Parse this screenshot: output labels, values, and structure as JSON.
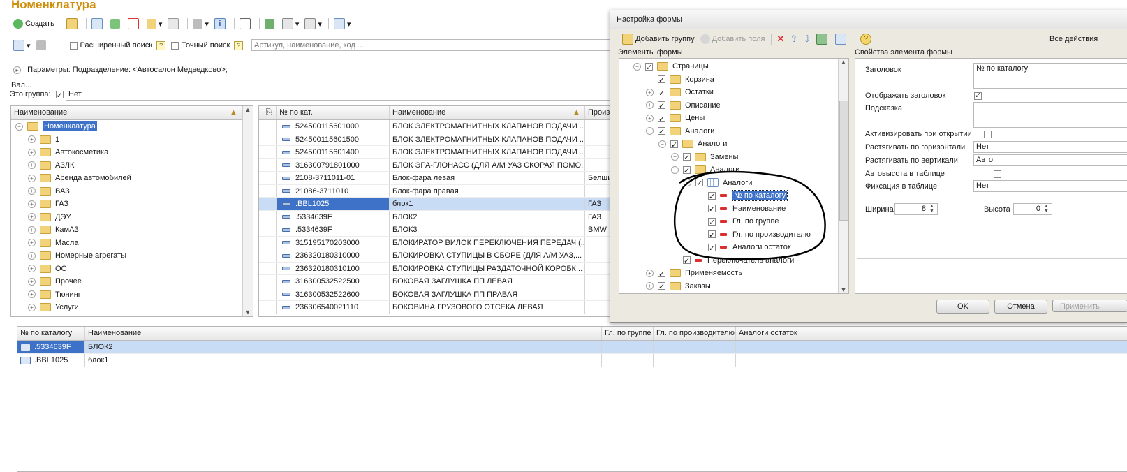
{
  "window_title": "Номенклатура",
  "toolbar": {
    "create_label": "Создать"
  },
  "search": {
    "extended_label": "Расширенный поиск",
    "exact_label": "Точный поиск",
    "placeholder": "Артикул, наименование, код ..."
  },
  "params_text": "Параметры: Подразделение: <Автосалон Медведково>; Вал...",
  "group_filter": {
    "label": "Это группа:",
    "value": "Нет"
  },
  "tree": {
    "header": "Наименование",
    "root": "Номенклатура",
    "items": [
      "1",
      "Автокосметика",
      "АЗЛК",
      "Аренда автомобилей",
      "ВАЗ",
      "ГАЗ",
      "ДЭУ",
      "КамАЗ",
      "Масла",
      "Номерные агрегаты",
      "ОС",
      "Прочее",
      "Тюнинг",
      "Услуги"
    ]
  },
  "items_table": {
    "columns": [
      "№ по кат.",
      "Наименование",
      "Произв"
    ],
    "rows": [
      {
        "code": "524500115601000",
        "name": "БЛОК ЭЛЕКТРОМАГНИТНЫХ КЛАПАНОВ ПОДАЧИ ...",
        "maker": ""
      },
      {
        "code": "524500115601500",
        "name": "БЛОК ЭЛЕКТРОМАГНИТНЫХ КЛАПАНОВ ПОДАЧИ ...",
        "maker": ""
      },
      {
        "code": "524500115601400",
        "name": "БЛОК ЭЛЕКТРОМАГНИТНЫХ КЛАПАНОВ ПОДАЧИ ...",
        "maker": ""
      },
      {
        "code": "316300791801000",
        "name": "БЛОК ЭРА-ГЛОНАСС (ДЛЯ А/М УАЗ СКОРАЯ ПОМО...",
        "maker": ""
      },
      {
        "code": "2108-3711011-01",
        "name": "Блок-фара левая",
        "maker": "Белши"
      },
      {
        "code": "21086-3711010",
        "name": "Блок-фара правая",
        "maker": ""
      },
      {
        "code": ".BBL1025",
        "name": "блок1",
        "maker": "ГАЗ"
      },
      {
        "code": ".5334639F",
        "name": "БЛОК2",
        "maker": "ГАЗ"
      },
      {
        "code": ".5334639F",
        "name": "БЛОК3",
        "maker": "BMW"
      },
      {
        "code": "315195170203000",
        "name": "БЛОКИРАТОР ВИЛОК ПЕРЕКЛЮЧЕНИЯ ПЕРЕДАЧ (...",
        "maker": ""
      },
      {
        "code": "236320180310000",
        "name": "БЛОКИРОВКА СТУПИЦЫ В СБОРЕ (ДЛЯ А/М УАЗ,...",
        "maker": ""
      },
      {
        "code": "236320180310100",
        "name": "БЛОКИРОВКА СТУПИЦЫ РАЗДАТОЧНОЙ КОРОБК...",
        "maker": ""
      },
      {
        "code": "316300532522500",
        "name": "БОКОВАЯ ЗАГЛУШКА ПП ЛЕВАЯ",
        "maker": ""
      },
      {
        "code": "316300532522600",
        "name": "БОКОВАЯ ЗАГЛУШКА ПП ПРАВАЯ",
        "maker": ""
      },
      {
        "code": "236306540021110",
        "name": "БОКОВИНА ГРУЗОВОГО ОТСЕКА ЛЕВАЯ",
        "maker": ""
      }
    ]
  },
  "analogs_table": {
    "columns": [
      "№ по каталогу",
      "Наименование",
      "Гл. по группе",
      "Гл. по производителю",
      "Аналоги остаток"
    ],
    "rows": [
      {
        "code": ".5334639F",
        "name": "БЛОК2"
      },
      {
        "code": ".BBL1025",
        "name": "блок1"
      }
    ]
  },
  "dialog": {
    "title": "Настройка формы",
    "add_group": "Добавить группу",
    "add_fields": "Добавить поля",
    "all_actions": "Все действия",
    "elements_label": "Элементы формы",
    "props_label": "Свойства элемента формы",
    "tree": [
      "Страницы",
      "Корзина",
      "Остатки",
      "Описание",
      "Цены",
      "Аналоги",
      "Аналоги",
      "Замены",
      "Аналоги",
      "Аналоги",
      "№ по каталогу",
      "Наименование",
      "Гл. по группе",
      "Гл. по производителю",
      "Аналоги остаток",
      "Переключатель аналоги",
      "Применяемость",
      "Заказы"
    ],
    "props": {
      "header_label": "Заголовок",
      "header_value": "№ по каталогу",
      "show_header": "Отображать заголовок",
      "hint": "Подсказка",
      "activate": "Активизировать при открытии",
      "stretch_h": "Растягивать по горизонтали",
      "stretch_h_value": "Нет",
      "stretch_v": "Растягивать по вертикали",
      "stretch_v_value": "Авто",
      "autoheight": "Автовысота в таблице",
      "fix": "Фиксация в таблице",
      "fix_value": "Нет",
      "width_label": "Ширина",
      "width_value": "8",
      "height_label": "Высота",
      "height_value": "0"
    },
    "ok": "OK",
    "cancel": "Отмена",
    "apply": "Применить"
  }
}
